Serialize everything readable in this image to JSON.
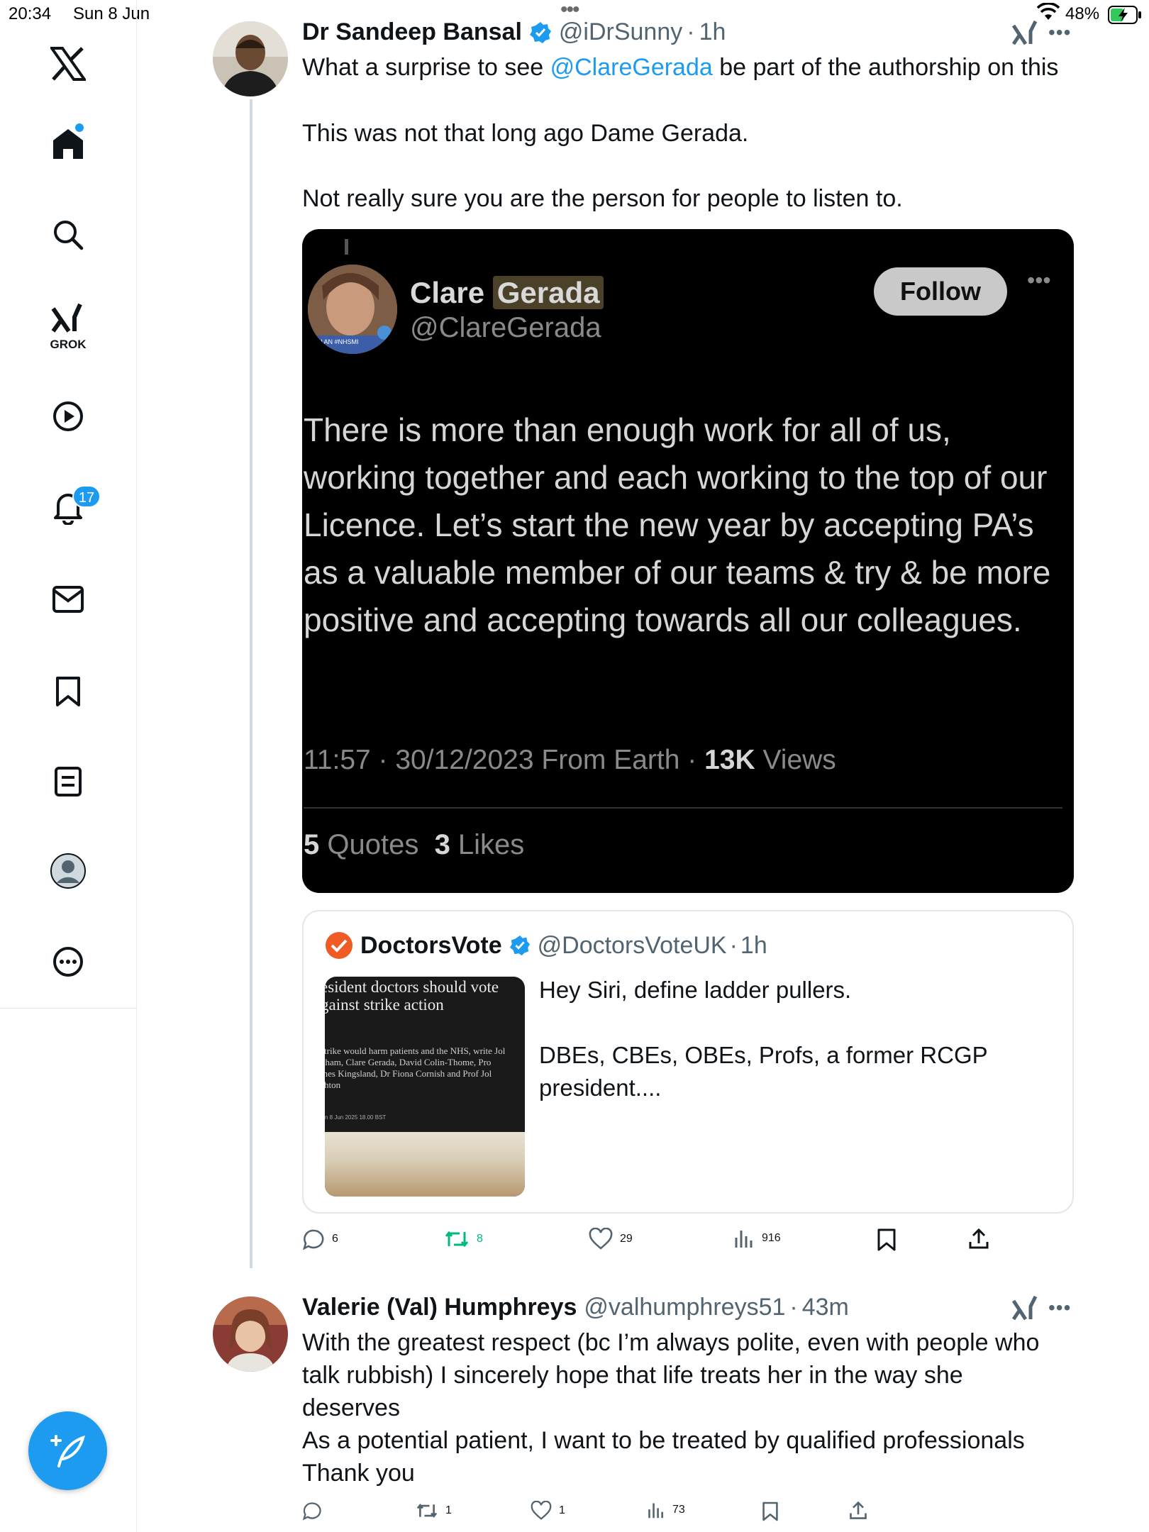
{
  "status_bar": {
    "time": "20:34",
    "date": "Sun 8 Jun",
    "battery": "48%"
  },
  "sidebar": {
    "items": [
      {
        "name": "x-logo"
      },
      {
        "name": "home"
      },
      {
        "name": "search"
      },
      {
        "name": "grok",
        "label": "GROK"
      },
      {
        "name": "video"
      },
      {
        "name": "notifications",
        "badge": "17"
      },
      {
        "name": "messages"
      },
      {
        "name": "bookmarks"
      },
      {
        "name": "lists"
      },
      {
        "name": "profile"
      },
      {
        "name": "more"
      }
    ]
  },
  "tweet1": {
    "author_name": "Dr Sandeep Bansal",
    "handle": "@iDrSunny",
    "time": "1h",
    "text_prefix": "What a surprise to see ",
    "mention": "@ClareGerada",
    "text_suffix": " be part of the authorship on this",
    "para2": "This was not that long ago Dame Gerada.",
    "para3": "Not really sure you are the person for people to listen to.",
    "embedded": {
      "name_first": "Clare",
      "name_last": "Gerada",
      "handle": "@ClareGerada",
      "follow_label": "Follow",
      "text": "There is more than enough work for all of us, working together and each working to the top of our Licence. Let’s start the new year by accepting PA’s as a valuable member of our teams & try & be more positive and accepting towards all our colleagues.",
      "meta_prefix": "11:57 · 30/12/2023 From Earth · ",
      "views_count": "13K",
      "views_label": " Views",
      "quotes_count": "5",
      "quotes_label": " Quotes",
      "likes_count": "3",
      "likes_label": " Likes",
      "avatar_caption": "N AN #NHSMI"
    },
    "quote": {
      "name": "DoctorsVote",
      "handle": "@DoctorsVoteUK",
      "time": "1h",
      "text": "Hey Siri, define ladder pullers.\n\nDBEs, CBEs, OBEs, Profs, a former RCGP president....",
      "thumb_headline": "esident doctors should vote\ngainst strike action",
      "thumb_sub": "strike would harm patients and the NHS, write Jol\ndham, Clare Gerada, David Colin-Thome, Pro\nmes Kingsland, Dr Fiona Cornish and Prof Jol\nshton",
      "thumb_date": "n 8 Jun 2025 18.00 BST"
    },
    "actions": {
      "replies": "6",
      "reposts": "8",
      "likes": "29",
      "views": "916"
    }
  },
  "tweet2": {
    "author_name": "Valerie (Val) Humphreys",
    "handle": "@valhumphreys51",
    "time": "43m",
    "text": "With the greatest respect (bc I’m always polite, even with people who\ntalk rubbish) I sincerely hope that life treats her in the way she\ndeserves\nAs a potential patient, I want to be treated by qualified professionals\nThank you",
    "actions": {
      "replies": "",
      "reposts": "1",
      "likes": "1",
      "views": "73"
    }
  },
  "colors": {
    "accent": "#1d9bf0",
    "repost_active": "#00ba7c",
    "muted": "#536471"
  }
}
